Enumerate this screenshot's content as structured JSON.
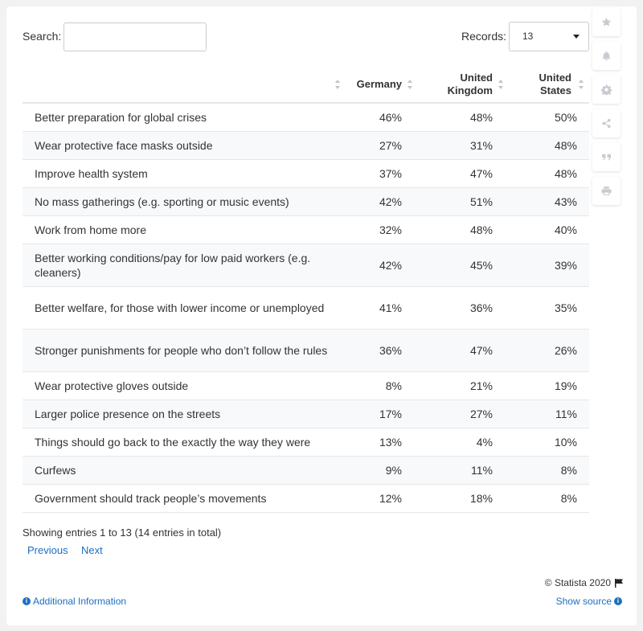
{
  "search": {
    "label": "Search:",
    "value": ""
  },
  "records": {
    "label": "Records:",
    "value": "13"
  },
  "chart_data": {
    "type": "table",
    "columns": [
      "",
      "Germany",
      "United Kingdom",
      "United States"
    ],
    "header_lines": [
      [
        ""
      ],
      [
        "Germany"
      ],
      [
        "United",
        "Kingdom"
      ],
      [
        "United",
        "States"
      ]
    ],
    "rows": [
      [
        "Better preparation for global crises",
        "46%",
        "48%",
        "50%"
      ],
      [
        "Wear protective face masks outside",
        "27%",
        "31%",
        "48%"
      ],
      [
        "Improve health system",
        "37%",
        "47%",
        "48%"
      ],
      [
        "No mass gatherings (e.g. sporting or music events)",
        "42%",
        "51%",
        "43%"
      ],
      [
        "Work from home more",
        "32%",
        "48%",
        "40%"
      ],
      [
        "Better working conditions/pay for low paid workers (e.g. cleaners)",
        "42%",
        "45%",
        "39%"
      ],
      [
        "Better welfare, for those with lower income or unemployed",
        "41%",
        "36%",
        "35%"
      ],
      [
        "Stronger punishments for people who don’t follow the rules",
        "36%",
        "47%",
        "26%"
      ],
      [
        "Wear protective gloves outside",
        "8%",
        "21%",
        "19%"
      ],
      [
        "Larger police presence on the streets",
        "17%",
        "27%",
        "11%"
      ],
      [
        "Things should go back to the exactly the way they were",
        "13%",
        "4%",
        "10%"
      ],
      [
        "Curfews",
        "9%",
        "11%",
        "8%"
      ],
      [
        "Government should track people’s movements",
        "12%",
        "18%",
        "8%"
      ]
    ]
  },
  "footer": {
    "showing": "Showing entries 1 to 13 (14 entries in total)",
    "previous": "Previous",
    "next": "Next",
    "copyright": "© Statista 2020",
    "additional_info": "Additional Information",
    "show_source": "Show source"
  },
  "tools": [
    "star-icon",
    "bell-icon",
    "gear-icon",
    "share-icon",
    "quote-icon",
    "print-icon"
  ],
  "colors": {
    "link": "#1c6fbf",
    "row_alt": "#f7f9fb",
    "border": "#e6e6e6"
  }
}
